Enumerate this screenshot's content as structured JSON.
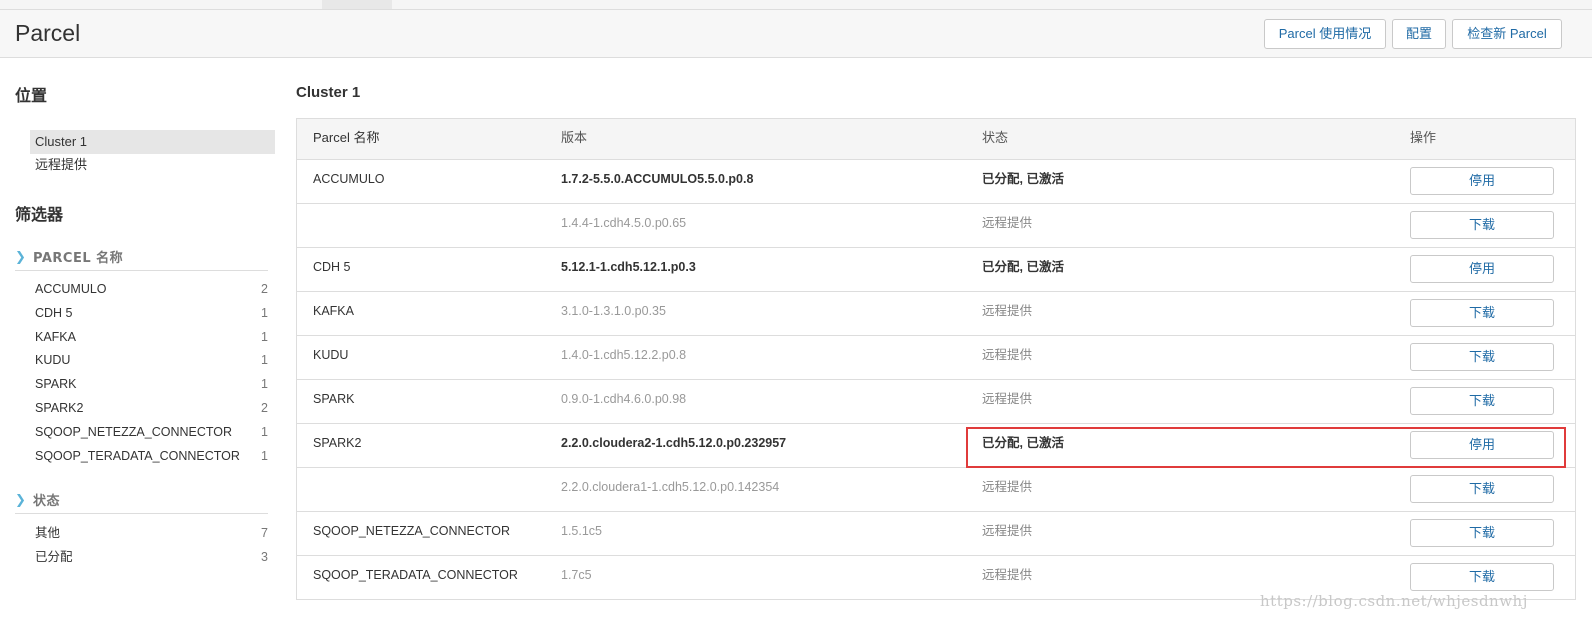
{
  "header": {
    "title": "Parcel",
    "buttons": {
      "usage": "Parcel 使用情况",
      "config": "配置",
      "check_new": "检查新 Parcel"
    }
  },
  "sidebar": {
    "location_heading": "位置",
    "locations": [
      "Cluster 1",
      "远程提供"
    ],
    "filter_heading": "筛选器",
    "parcel_group": {
      "label": "PARCEL 名称",
      "items": [
        {
          "name": "ACCUMULO",
          "count": "2"
        },
        {
          "name": "CDH 5",
          "count": "1"
        },
        {
          "name": "KAFKA",
          "count": "1"
        },
        {
          "name": "KUDU",
          "count": "1"
        },
        {
          "name": "SPARK",
          "count": "1"
        },
        {
          "name": "SPARK2",
          "count": "2"
        },
        {
          "name": "SQOOP_NETEZZA_CONNECTOR",
          "count": "1"
        },
        {
          "name": "SQOOP_TERADATA_CONNECTOR",
          "count": "1"
        }
      ]
    },
    "status_group": {
      "label": "状态",
      "items": [
        {
          "name": "其他",
          "count": "7"
        },
        {
          "name": "已分配",
          "count": "3"
        }
      ]
    }
  },
  "main": {
    "cluster_title": "Cluster 1",
    "columns": [
      "Parcel 名称",
      "版本",
      "状态",
      "操作"
    ],
    "rows": [
      {
        "name": "ACCUMULO",
        "version": "1.7.2-5.5.0.ACCUMULO5.5.0.p0.8",
        "status": "已分配, 已激活",
        "action": "停用",
        "emphasis": true
      },
      {
        "name": "",
        "version": "1.4.4-1.cdh4.5.0.p0.65",
        "status": "远程提供",
        "action": "下载",
        "emphasis": false
      },
      {
        "name": "CDH 5",
        "version": "5.12.1-1.cdh5.12.1.p0.3",
        "status": "已分配, 已激活",
        "action": "停用",
        "emphasis": true
      },
      {
        "name": "KAFKA",
        "version": "3.1.0-1.3.1.0.p0.35",
        "status": "远程提供",
        "action": "下载",
        "emphasis": false
      },
      {
        "name": "KUDU",
        "version": "1.4.0-1.cdh5.12.2.p0.8",
        "status": "远程提供",
        "action": "下载",
        "emphasis": false
      },
      {
        "name": "SPARK",
        "version": "0.9.0-1.cdh4.6.0.p0.98",
        "status": "远程提供",
        "action": "下载",
        "emphasis": false
      },
      {
        "name": "SPARK2",
        "version": "2.2.0.cloudera2-1.cdh5.12.0.p0.232957",
        "status": "已分配, 已激活",
        "action": "停用",
        "emphasis": true
      },
      {
        "name": "",
        "version": "2.2.0.cloudera1-1.cdh5.12.0.p0.142354",
        "status": "远程提供",
        "action": "下载",
        "emphasis": false
      },
      {
        "name": "SQOOP_NETEZZA_CONNECTOR",
        "version": "1.5.1c5",
        "status": "远程提供",
        "action": "下载",
        "emphasis": false
      },
      {
        "name": "SQOOP_TERADATA_CONNECTOR",
        "version": "1.7c5",
        "status": "远程提供",
        "action": "下载",
        "emphasis": false
      }
    ]
  },
  "watermark": "https://blog.csdn.net/whjesdnwhj",
  "colors": {
    "link": "#1f6aa5",
    "highlight": "#e03b3b",
    "chevron": "#5bb3d8"
  }
}
